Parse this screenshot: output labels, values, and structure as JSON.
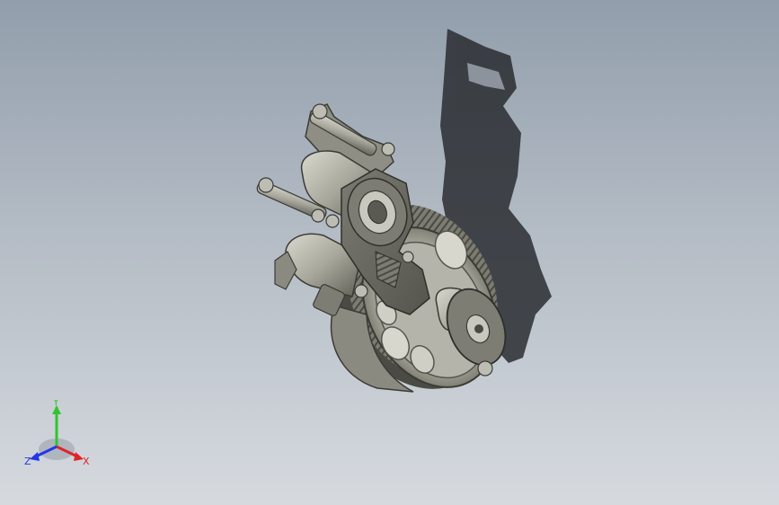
{
  "viewport": {
    "background_top": "#929eac",
    "background_bottom": "#d6dadf"
  },
  "model": {
    "body_color": "#8f8f84",
    "shadow_color": "#2a2d31"
  },
  "triad": {
    "x_label": "X",
    "y_label": "Y",
    "z_label": "Z",
    "x_color": "#e0242b",
    "y_color": "#2fc52b",
    "z_color": "#2338e6"
  }
}
